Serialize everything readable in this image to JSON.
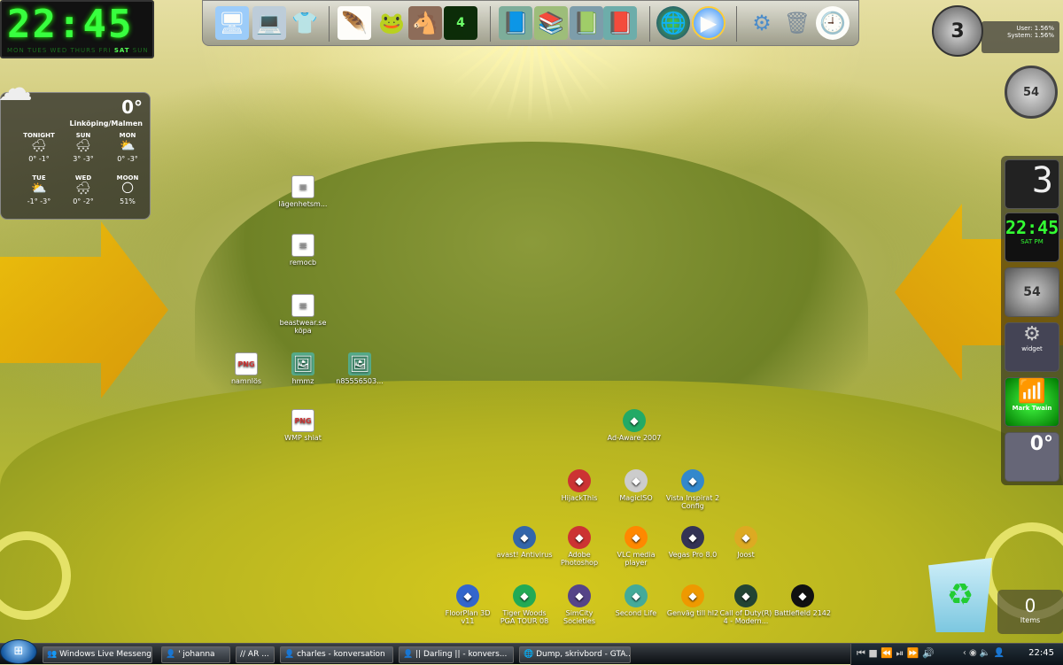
{
  "clock": {
    "time": "22:45",
    "days": "MON TUES WED THURS FRI",
    "day_active": "SAT",
    "day_tail": "SUN"
  },
  "dock": {
    "icons": [
      "computer-icon",
      "laptop-icon",
      "tshirt-icon",
      "feather-icon",
      "frog-icon",
      "horse-icon",
      "cod4-icon",
      "book-icon",
      "books-icon",
      "book2-icon",
      "book3-icon",
      "globe-icon",
      "media-player-icon",
      "gears-icon",
      "recycle-bin-icon",
      "clock-icon"
    ]
  },
  "weather": {
    "temp": "0°",
    "location": "Linköping/Malmen",
    "days": [
      {
        "label": "TONIGHT",
        "temps": "0° -1°"
      },
      {
        "label": "SUN",
        "temps": "3° -3°"
      },
      {
        "label": "MON",
        "temps": "0° -3°"
      },
      {
        "label": "TUE",
        "temps": "-1° -3°"
      },
      {
        "label": "WED",
        "temps": "0° -2°"
      },
      {
        "label": "MOON",
        "temps": "51%"
      }
    ]
  },
  "cpu": {
    "digit": "3",
    "user": "User: 1.56%",
    "system": "System: 1.56%"
  },
  "gauge": {
    "value": "54"
  },
  "sidebar": {
    "clock": "22:45",
    "day": "SAT",
    "pm": "PM",
    "gauge": "54",
    "widget": "widget",
    "wifi": "Mark Twain",
    "temp": "0°",
    "digit": "3"
  },
  "desktop_icons": [
    {
      "label": "lägenhetsm...",
      "type": "doc"
    },
    {
      "label": "remocb",
      "type": "doc"
    },
    {
      "label": "beastwear.se köpa",
      "type": "doc"
    },
    {
      "label": "namnlös",
      "type": "png"
    },
    {
      "label": "hmmz",
      "type": "img"
    },
    {
      "label": "n85556503...",
      "type": "img"
    },
    {
      "label": "WMP shiat",
      "type": "png"
    },
    {
      "label": "Ad-Aware 2007",
      "type": "app"
    },
    {
      "label": "HijackThis",
      "type": "app"
    },
    {
      "label": "MagicISO",
      "type": "app"
    },
    {
      "label": "Vista Inspirat 2 Config",
      "type": "app"
    },
    {
      "label": "avast! Antivirus",
      "type": "app"
    },
    {
      "label": "Adobe Photoshop",
      "type": "app"
    },
    {
      "label": "VLC media player",
      "type": "app"
    },
    {
      "label": "Vegas Pro 8.0",
      "type": "app"
    },
    {
      "label": "Joost",
      "type": "app"
    },
    {
      "label": "FloorPlan 3D v11",
      "type": "app"
    },
    {
      "label": "Tiger Woods PGA TOUR 08",
      "type": "app"
    },
    {
      "label": "SimCity Societies",
      "type": "app"
    },
    {
      "label": "Second Life",
      "type": "app"
    },
    {
      "label": "Genväg till hl2",
      "type": "app"
    },
    {
      "label": "Call of Duty(R) 4 - Modern...",
      "type": "app"
    },
    {
      "label": "Battlefield 2142",
      "type": "app"
    }
  ],
  "recycle": {
    "count": "0",
    "label": "Items"
  },
  "taskbar": {
    "tasks": [
      "Windows Live Messenger",
      "' johanna",
      "// AR ...",
      "charles - konversation",
      "|| Darling || - konvers...",
      "Dump, skrivbord - GTA..."
    ],
    "time": "22:45"
  }
}
